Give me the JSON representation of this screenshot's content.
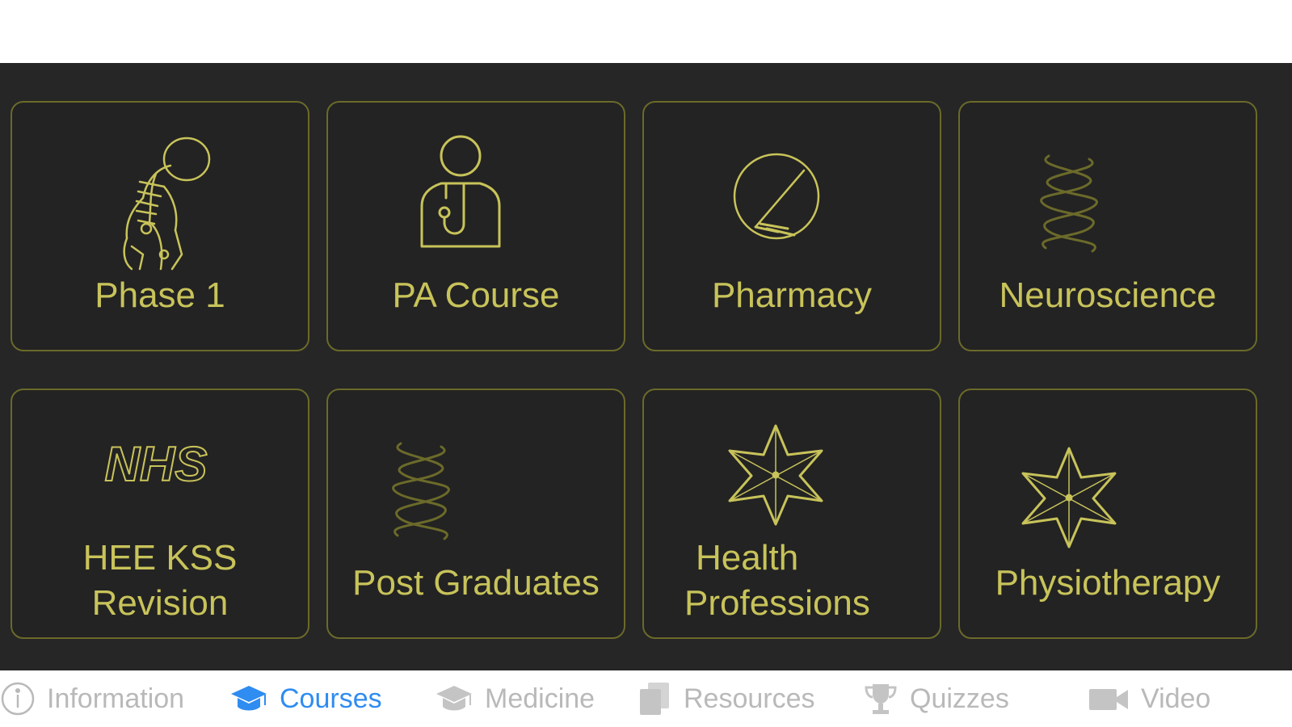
{
  "colors": {
    "panel_bg": "#262626",
    "tile_border": "#6b6a2a",
    "accent_gold": "#c8c35a",
    "nav_inactive": "#b9b9b9",
    "nav_active": "#2f8cf0"
  },
  "tiles": [
    {
      "label_lines": [
        "Phase 1"
      ],
      "icon": "skeleton-icon"
    },
    {
      "label_lines": [
        "PA Course"
      ],
      "icon": "doctor-stethoscope-icon"
    },
    {
      "label_lines": [
        "Pharmacy"
      ],
      "icon": "pill-icon"
    },
    {
      "label_lines": [
        "Neuroscience"
      ],
      "icon": "dna-helix-icon"
    },
    {
      "label_lines": [
        "HEE KSS",
        "Revision"
      ],
      "icon": "nhs-logo-icon",
      "logo_text": "NHS"
    },
    {
      "label_lines": [
        "Post Graduates"
      ],
      "icon": "dna-helix-icon"
    },
    {
      "label_lines": [
        "Health",
        "Professions"
      ],
      "icon": "star-of-life-icon"
    },
    {
      "label_lines": [
        "Physiotherapy"
      ],
      "icon": "star-of-life-icon"
    }
  ],
  "bottom_nav": [
    {
      "label": "Information",
      "icon": "info-icon",
      "active": false
    },
    {
      "label": "Courses",
      "icon": "graduation-cap-icon",
      "active": true
    },
    {
      "label": "Medicine",
      "icon": "graduation-cap-icon",
      "active": false
    },
    {
      "label": "Resources",
      "icon": "documents-icon",
      "active": false
    },
    {
      "label": "Quizzes",
      "icon": "trophy-icon",
      "active": false
    },
    {
      "label": "Video",
      "icon": "video-camera-icon",
      "active": false
    }
  ]
}
